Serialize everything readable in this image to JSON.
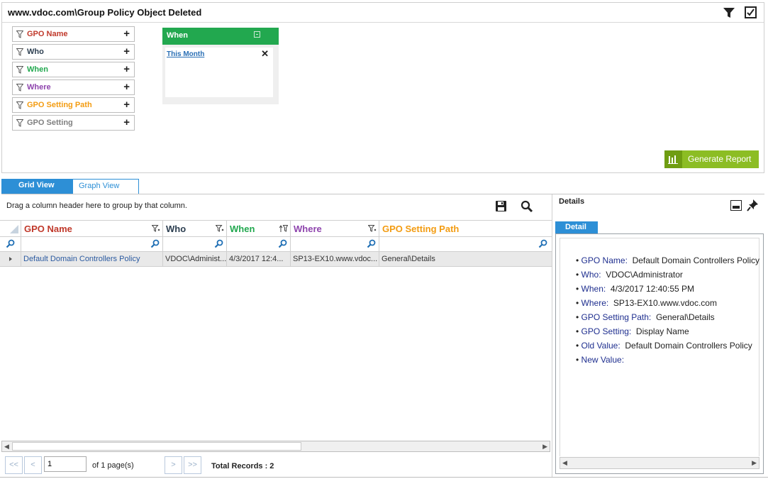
{
  "title": "www.vdoc.com\\Group Policy Object Deleted",
  "colors": {
    "gpo_name": "#c0392b",
    "who": "#2c3e50",
    "when": "#22a84f",
    "where": "#8e44ad",
    "gpo_setting_path": "#f39c12",
    "gpo_setting": "#808080",
    "accent": "#2d8fd6",
    "report_button": "#8cbd24"
  },
  "filters": [
    {
      "label": "GPO Name"
    },
    {
      "label": "Who"
    },
    {
      "label": "When"
    },
    {
      "label": "Where"
    },
    {
      "label": "GPO Setting Path"
    },
    {
      "label": "GPO Setting"
    }
  ],
  "when_card": {
    "title": "When",
    "value": "This Month"
  },
  "generate_report": "Generate Report",
  "tabs": {
    "grid": "Grid View",
    "graph": "Graph View"
  },
  "grid": {
    "group_hint": "Drag a column header here to group by that column.",
    "columns": [
      "GPO Name",
      "Who",
      "When",
      "Where",
      "GPO Setting Path"
    ],
    "rows": [
      [
        "Default Domain Controllers Policy",
        "VDOC\\Administ...",
        "4/3/2017 12:4...",
        "SP13-EX10.www.vdoc...",
        "General\\Details"
      ]
    ]
  },
  "pager": {
    "first": "<<",
    "prev": "<",
    "page_value": "1",
    "of_pages": "of 1 page(s)",
    "next": ">",
    "last": ">>",
    "total_records": "Total Records : 2"
  },
  "details": {
    "title": "Details",
    "tab": "Detail",
    "items": [
      {
        "key": "GPO Name:",
        "value": "Default Domain Controllers Policy"
      },
      {
        "key": "Who:",
        "value": "VDOC\\Administrator"
      },
      {
        "key": "When:",
        "value": "4/3/2017 12:40:55 PM"
      },
      {
        "key": "Where:",
        "value": "SP13-EX10.www.vdoc.com"
      },
      {
        "key": "GPO Setting Path:",
        "value": "General\\Details"
      },
      {
        "key": "GPO Setting:",
        "value": "Display Name"
      },
      {
        "key": "Old Value:",
        "value": "Default Domain Controllers Policy"
      },
      {
        "key": "New Value:",
        "value": ""
      }
    ]
  }
}
